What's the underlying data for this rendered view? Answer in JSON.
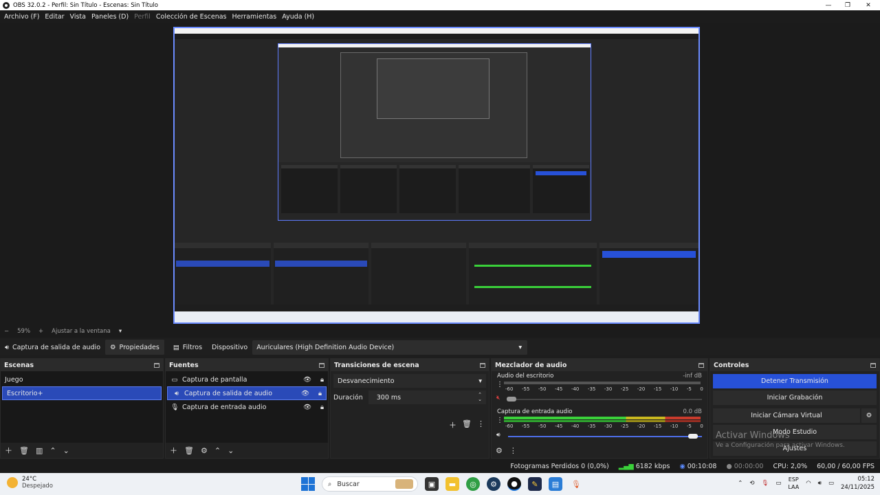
{
  "window": {
    "title": "OBS 32.0.2 - Perfil: Sin Título - Escenas: Sin Título",
    "minimize": "—",
    "maximize": "❐",
    "close": "✕"
  },
  "menu": [
    {
      "label": "Archivo (F)"
    },
    {
      "label": "Editar"
    },
    {
      "label": "Vista"
    },
    {
      "label": "Paneles (D)"
    },
    {
      "label": "Perfil",
      "disabled": true
    },
    {
      "label": "Colección de Escenas"
    },
    {
      "label": "Herramientas"
    },
    {
      "label": "Ayuda (H)"
    }
  ],
  "zoom": {
    "minus": "−",
    "value": "59%",
    "plus": "+",
    "fit": "Ajustar a la ventana",
    "caret": "▾"
  },
  "source_toolbar": {
    "source_name": "Captura de salida de audio",
    "properties": "Propiedades",
    "filters": "Filtros",
    "device_label": "Dispositivo",
    "device_value": "Auriculares (High Definition Audio Device)"
  },
  "scenes": {
    "title": "Escenas",
    "items": [
      "Juego",
      "Escritorio+"
    ],
    "selected": 1
  },
  "sources": {
    "title": "Fuentes",
    "items": [
      {
        "label": "Captura de pantalla",
        "icon": "monitor-icon"
      },
      {
        "label": "Captura de salida de audio",
        "icon": "speaker-icon"
      },
      {
        "label": "Captura de entrada audio",
        "icon": "microphone-icon"
      }
    ],
    "selected": 1
  },
  "transitions": {
    "title": "Transiciones de escena",
    "type": "Desvanecimiento",
    "duration_label": "Duración",
    "duration_value": "300 ms"
  },
  "mixer": {
    "title": "Mezclador de audio",
    "ticks": [
      "-60",
      "-55",
      "-50",
      "-45",
      "-40",
      "-35",
      "-30",
      "-25",
      "-20",
      "-15",
      "-10",
      "-5",
      "0"
    ],
    "channels": [
      {
        "name": "Audio del escritorio",
        "db": "-inf dB",
        "muted": true,
        "level": 0
      },
      {
        "name": "Captura de entrada audio",
        "db": "0.0 dB",
        "muted": false,
        "level": 1.0
      }
    ]
  },
  "controls": {
    "title": "Controles",
    "buttons": [
      "Detener Transmisión",
      "Iniciar Grabación",
      "Iniciar Cámara Virtual",
      "Modo Estudio",
      "Ajustes"
    ]
  },
  "activation": {
    "line1": "Activar Windows",
    "line2": "Ve a Configuración para activar Windows."
  },
  "status": {
    "dropped": "Fotogramas Perdidos 0 (0,0%)",
    "bitrate": "6182 kbps",
    "stream_time": "00:10:08",
    "rec_time": "00:00:00",
    "cpu": "CPU: 2,0%",
    "fps": "60,00 / 60,00 FPS"
  },
  "taskbar": {
    "temp": "24°C",
    "weather": "Despejado",
    "search": "Buscar",
    "lang1": "ESP",
    "lang2": "LAA",
    "time": "05:12",
    "date": "24/11/2025"
  },
  "colors": {
    "accent": "#2a4ab8",
    "primary_button": "#2751d8",
    "meter_green": "#3ad13a",
    "meter_yellow": "#c9b81f",
    "meter_red": "#c93b2c"
  }
}
